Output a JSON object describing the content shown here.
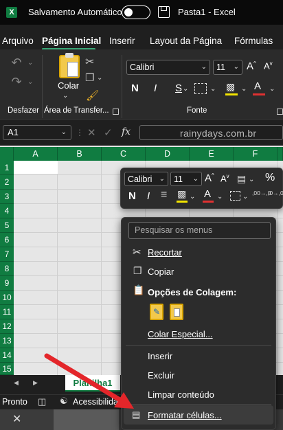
{
  "titlebar": {
    "app_icon": "excel-icon",
    "autosave_label": "Salvamento Automático",
    "autosave_state": "off",
    "save_icon": "save-icon",
    "window_title": "Pasta1  -  Excel"
  },
  "menu": {
    "items": [
      "Arquivo",
      "Página Inicial",
      "Inserir",
      "Layout da Página",
      "Fórmulas"
    ],
    "active": "Página Inicial"
  },
  "ribbon": {
    "undo_group_label": "Desfazer",
    "clipboard": {
      "paste_label": "Colar",
      "group_label": "Área de Transfer..."
    },
    "font": {
      "name": "Calibri",
      "size": "11",
      "group_label": "Fonte",
      "bold": "N",
      "italic": "I",
      "underline": "S",
      "grow": "A",
      "shrink": "A",
      "fill_color": "#f3e500",
      "font_color": "#e03131",
      "border_icon": "borders-icon"
    }
  },
  "formula_bar": {
    "name_box": "A1",
    "fx_label": "fx",
    "watermark": "rainydays.com.br"
  },
  "grid": {
    "columns": [
      "A",
      "B",
      "C",
      "D",
      "E",
      "F"
    ],
    "rows": [
      "1",
      "2",
      "3",
      "4",
      "5",
      "6",
      "7",
      "8",
      "9",
      "10",
      "11",
      "12",
      "13",
      "14",
      "15"
    ],
    "header_color": "#107c41"
  },
  "sheet_tab": "Planilha1",
  "status": {
    "ready": "Pronto",
    "accessibility": "Acessibilidad"
  },
  "mini_toolbar": {
    "font_name": "Calibri",
    "font_size": "11",
    "percent": "%",
    "bold": "N",
    "italic": "I",
    "grow": "A",
    "shrink": "A",
    "fill_color": "#f3e500",
    "font_color": "#e03131",
    "dec_increase": ",00→,0",
    "dec_decrease": ",0→,00"
  },
  "context_menu": {
    "search_placeholder": "Pesquisar os menus",
    "items": {
      "cut": "Recortar",
      "copy": "Copiar",
      "paste_options": "Opções de Colagem:",
      "paste_special": "Colar Especial...",
      "insert": "Inserir",
      "delete": "Excluir",
      "clear": "Limpar conteúdo",
      "format": "Formatar células..."
    }
  },
  "annotation": {
    "arrow_color": "#e3262a"
  }
}
